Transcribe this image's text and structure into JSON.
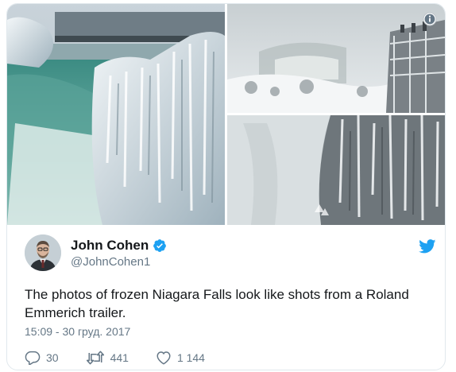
{
  "tweet": {
    "author_name": "John Cohen",
    "author_handle": "@JohnCohen1",
    "text": "The photos of frozen Niagara Falls look like shots from a Roland Emmerich trailer.",
    "timestamp": "15:09 - 30 груд. 2017",
    "actions": {
      "replies": "30",
      "retweets": "441",
      "likes": "1 144"
    }
  },
  "media": {
    "photo_count": 3,
    "info_icon": "info-icon"
  },
  "colors": {
    "twitter_blue": "#1da1f2",
    "verified_blue": "#1da1f2",
    "text_primary": "#14171a",
    "text_secondary": "#657786",
    "border": "#e1e8ed"
  },
  "icons": [
    "info-icon",
    "verified-badge-icon",
    "twitter-bird-icon",
    "reply-icon",
    "retweet-icon",
    "like-icon"
  ]
}
